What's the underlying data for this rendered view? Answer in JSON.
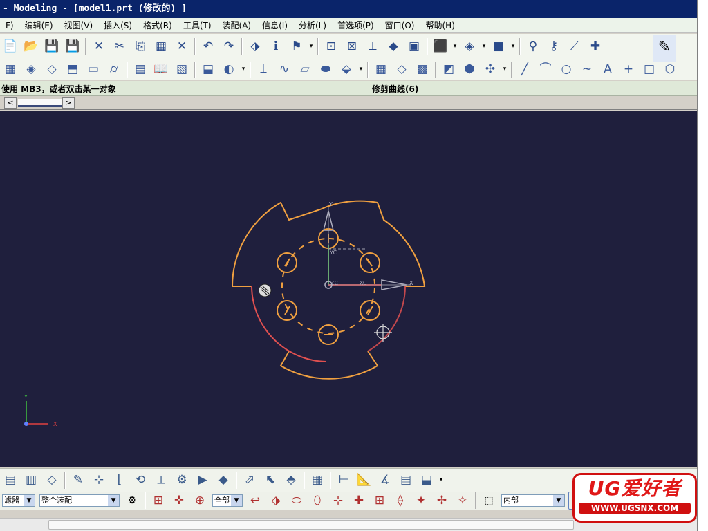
{
  "window": {
    "title": "- Modeling - [model1.prt  (修改的) ]"
  },
  "menu": {
    "items": [
      "F)",
      "编辑(E)",
      "视图(V)",
      "插入(S)",
      "格式(R)",
      "工具(T)",
      "装配(A)",
      "信息(I)",
      "分析(L)",
      "首选项(P)",
      "窗口(O)",
      "帮助(H)"
    ]
  },
  "toolbar1": {
    "icons": [
      {
        "name": "new-icon",
        "glyph": "📄"
      },
      {
        "name": "open-icon",
        "glyph": "📂"
      },
      {
        "name": "save-icon",
        "glyph": "💾"
      },
      {
        "name": "save-as-icon",
        "glyph": "💾"
      },
      {
        "sep": true
      },
      {
        "name": "delete-icon",
        "glyph": "✕"
      },
      {
        "name": "cut-icon",
        "glyph": "✂"
      },
      {
        "name": "copy-icon",
        "glyph": "⎘"
      },
      {
        "name": "paste-icon",
        "glyph": "▦"
      },
      {
        "name": "delete-x-icon",
        "glyph": "✕"
      },
      {
        "sep": true
      },
      {
        "name": "undo-icon",
        "glyph": "↶"
      },
      {
        "name": "redo-icon",
        "glyph": "↷"
      },
      {
        "sep": true
      },
      {
        "name": "edit-object-icon",
        "glyph": "⬗"
      },
      {
        "name": "info-icon",
        "glyph": "ℹ"
      },
      {
        "name": "flag-icon",
        "glyph": "⚑"
      },
      {
        "dd": true
      },
      {
        "sep": true
      },
      {
        "name": "fit-view-icon",
        "glyph": "⊡"
      },
      {
        "name": "zoom-icon",
        "glyph": "⊠"
      },
      {
        "name": "wcs-icon",
        "glyph": "⟂"
      },
      {
        "name": "shaded-icon",
        "glyph": "◆"
      },
      {
        "name": "layout-icon",
        "glyph": "▣"
      },
      {
        "sep": true
      },
      {
        "name": "cube-view-icon",
        "glyph": "⬛"
      },
      {
        "dd": true
      },
      {
        "name": "render-icon",
        "glyph": "◈"
      },
      {
        "dd": true
      },
      {
        "name": "color-icon",
        "glyph": "■"
      },
      {
        "dd": true
      },
      {
        "sep": true
      },
      {
        "name": "sketch-icon",
        "glyph": "⚲"
      },
      {
        "name": "dimension-icon",
        "glyph": "⚷"
      },
      {
        "name": "trim-curve-icon",
        "glyph": "⟋"
      },
      {
        "name": "extend-icon",
        "glyph": "✚"
      }
    ]
  },
  "toolbar2": {
    "icons": [
      {
        "name": "surface-grid-icon",
        "glyph": "▦"
      },
      {
        "name": "surface-mesh-icon",
        "glyph": "◈"
      },
      {
        "name": "surface-patch-icon",
        "glyph": "◇"
      },
      {
        "name": "surface-sweep-icon",
        "glyph": "⬒"
      },
      {
        "name": "surface-ruled-icon",
        "glyph": "▭"
      },
      {
        "name": "cylinder-icon",
        "glyph": "⌭"
      },
      {
        "sep": true
      },
      {
        "name": "thicken-icon",
        "glyph": "▤"
      },
      {
        "name": "book-icon",
        "glyph": "📖"
      },
      {
        "name": "feature-group-icon",
        "glyph": "▧"
      },
      {
        "sep": true
      },
      {
        "name": "extrude-icon",
        "glyph": "⬓"
      },
      {
        "name": "revolve-icon",
        "glyph": "◐"
      },
      {
        "dd": true
      },
      {
        "sep": true
      },
      {
        "name": "datum-axis-icon",
        "glyph": "⟘"
      },
      {
        "name": "spline-icon",
        "glyph": "∿"
      },
      {
        "name": "offset-surface-icon",
        "glyph": "▱"
      },
      {
        "name": "sew-icon",
        "glyph": "⬬"
      },
      {
        "name": "patch-icon",
        "glyph": "⬙"
      },
      {
        "dd": true
      },
      {
        "sep": true
      },
      {
        "name": "mesh-surface-icon",
        "glyph": "▦"
      },
      {
        "name": "bounded-plane-icon",
        "glyph": "◇"
      },
      {
        "name": "grid-surface-icon",
        "glyph": "▩"
      },
      {
        "sep": true
      },
      {
        "name": "section-view-icon",
        "glyph": "◩"
      },
      {
        "name": "block-icon",
        "glyph": "⬢"
      },
      {
        "name": "transform-icon",
        "glyph": "✣"
      },
      {
        "dd": true
      },
      {
        "sep": true
      },
      {
        "name": "line-icon",
        "glyph": "╱"
      },
      {
        "name": "arc-icon",
        "glyph": "⌒"
      },
      {
        "name": "circle-icon",
        "glyph": "○"
      },
      {
        "name": "curve-icon",
        "glyph": "∼"
      },
      {
        "name": "text-icon",
        "glyph": "A"
      },
      {
        "name": "point-icon",
        "glyph": "+"
      },
      {
        "name": "rectangle-icon",
        "glyph": "□"
      },
      {
        "name": "polygon-icon",
        "glyph": "⬡"
      }
    ]
  },
  "prompt": {
    "cue": "使用 MB3，或者双击某一对象",
    "status": "修剪曲线(6)"
  },
  "selection": {
    "type_filter": "滤器",
    "scope": "整个装配",
    "snap_scope": "全部",
    "range": "内部"
  },
  "selection_bar": {
    "icons": [
      {
        "name": "layer-icon",
        "glyph": "▤"
      },
      {
        "name": "layer-settings-icon",
        "glyph": "▥"
      },
      {
        "name": "layer-move-icon",
        "glyph": "◇"
      },
      {
        "sep": true
      },
      {
        "name": "sketch-edit-icon",
        "glyph": "✎"
      },
      {
        "name": "sketch-constraint-icon",
        "glyph": "⊹"
      },
      {
        "name": "wcs-origin-icon",
        "glyph": "⌊"
      },
      {
        "name": "wcs-rotate-icon",
        "glyph": "⟲"
      },
      {
        "name": "wcs-dynamic-icon",
        "glyph": "⟂"
      },
      {
        "name": "wcs-set-icon",
        "glyph": "⚙"
      },
      {
        "name": "wcs-display-icon",
        "glyph": "▶"
      },
      {
        "name": "wcs-save-icon",
        "glyph": "◆"
      },
      {
        "sep": true
      },
      {
        "name": "select-icon",
        "glyph": "⬀"
      },
      {
        "name": "select-feature-icon",
        "glyph": "⬉"
      },
      {
        "name": "select-face-icon",
        "glyph": "⬘"
      },
      {
        "sep": true
      },
      {
        "name": "grid-icon",
        "glyph": "▦"
      },
      {
        "sep": true
      },
      {
        "name": "measure-icon",
        "glyph": "⊢"
      },
      {
        "name": "ruler-icon",
        "glyph": "📐"
      },
      {
        "name": "measure-angle-icon",
        "glyph": "∡"
      },
      {
        "name": "table-icon",
        "glyph": "▤"
      },
      {
        "name": "report-icon",
        "glyph": "⬓"
      },
      {
        "dd": true
      }
    ]
  },
  "filter_bar": {
    "icons": [
      {
        "name": "snap-endpoint-icon",
        "glyph": "⊞"
      },
      {
        "name": "snap-midpoint-icon",
        "glyph": "✛"
      },
      {
        "name": "snap-center-icon",
        "glyph": "⊕"
      },
      {
        "name": "undo-selection-icon",
        "glyph": "↩"
      },
      {
        "name": "select-solid-icon",
        "glyph": "⬗"
      },
      {
        "name": "select-edge-icon",
        "glyph": "⬭"
      },
      {
        "name": "select-curve-icon",
        "glyph": "⬯"
      },
      {
        "name": "select-point-icon",
        "glyph": "⊹"
      },
      {
        "name": "select-intersection-icon",
        "glyph": "✚"
      },
      {
        "name": "select-quadrant-icon",
        "glyph": "⊞"
      },
      {
        "name": "select-tangent-icon",
        "glyph": "⟠"
      },
      {
        "name": "select-vertex-icon",
        "glyph": "✦"
      },
      {
        "name": "select-arc-icon",
        "glyph": "✢"
      },
      {
        "name": "select-misc-icon",
        "glyph": "✧"
      }
    ]
  },
  "viewport": {
    "background": "#1f1f3d",
    "curve_color": "#f0a040",
    "highlight_color": "#e05050",
    "axis_labels": {
      "x": "X",
      "y": "Y",
      "wcs_x": "XC",
      "wcs_y": "YC",
      "origin": "ZC"
    }
  },
  "watermark": {
    "title": "UG爱好者",
    "url": "WWW.UGSNX.COM"
  }
}
